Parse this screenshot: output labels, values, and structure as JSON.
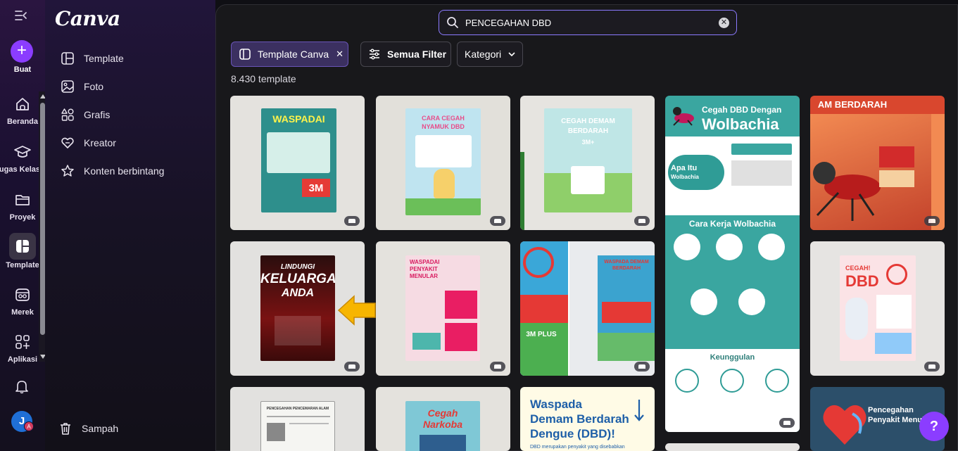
{
  "rail": {
    "create_label": "Buat",
    "items": [
      {
        "label": "Beranda",
        "icon": "home-icon"
      },
      {
        "label": "Tugas Kelas",
        "icon": "graduation-cap-icon"
      },
      {
        "label": "Proyek",
        "icon": "folder-icon"
      },
      {
        "label": "Template",
        "icon": "template-icon"
      },
      {
        "label": "Merek",
        "icon": "brand-icon"
      },
      {
        "label": "Aplikasi",
        "icon": "apps-icon"
      }
    ],
    "avatar_initial": "J",
    "avatar_badge": "A"
  },
  "panel": {
    "logo": "Canva",
    "items": [
      {
        "label": "Template",
        "icon": "template-icon"
      },
      {
        "label": "Foto",
        "icon": "photo-icon"
      },
      {
        "label": "Grafis",
        "icon": "shapes-icon"
      },
      {
        "label": "Kreator",
        "icon": "heart-icon"
      },
      {
        "label": "Konten berbintang",
        "icon": "star-icon"
      }
    ],
    "trash_label": "Sampah"
  },
  "search": {
    "value": "PENCEGAHAN DBD"
  },
  "filters": {
    "template_chip": "Template Canva",
    "all_filters": "Semua Filter",
    "category": "Kategori"
  },
  "results": {
    "count": "8.430 template"
  },
  "cards": {
    "c1": {
      "line1": "WASPADAI",
      "line2": "3M"
    },
    "c2": {
      "line1": "CARA CEGAH",
      "line2": "NYAMUK DBD"
    },
    "c3": {
      "line1": "CEGAH DEMAM",
      "line2": "BERDARAH",
      "line3": "3M+"
    },
    "c4": {
      "title1": "Cegah DBD Dengan",
      "title2": "Wolbachia",
      "q": "Apa Itu",
      "q2": "Wolbachia",
      "sec": "Cara Kerja Wolbachia",
      "sec2": "Keunggulan"
    },
    "c5": {
      "line1": "AM BERDARAH"
    },
    "c6": {
      "line1": "LINDUNGI",
      "line2": "KELUARGA",
      "line3": "ANDA"
    },
    "c7": {
      "line1": "WASPADAI",
      "line2": "PENYAKIT",
      "line3": "MENULAR"
    },
    "c8": {
      "line1": "WASPADA DEMAM",
      "line2": "BERDARAH",
      "line3": "3M PLUS"
    },
    "c10": {
      "line1": "CEGAH!",
      "line2": "DBD"
    },
    "c11": {
      "line1": "PENCEGAHAN PENCEMARAN ALAM"
    },
    "c12": {
      "line1": "Cegah",
      "line2": "Narkoba"
    },
    "c13": {
      "line1": "Waspada",
      "line2": "Demam Berdarah",
      "line3": "Dengue (DBD)!",
      "line4": "DBD merupakan penyakit yang disebabkan"
    },
    "c15": {
      "line1": "Pencegahan",
      "line2": "Penyakit Menul"
    }
  },
  "help": "?"
}
